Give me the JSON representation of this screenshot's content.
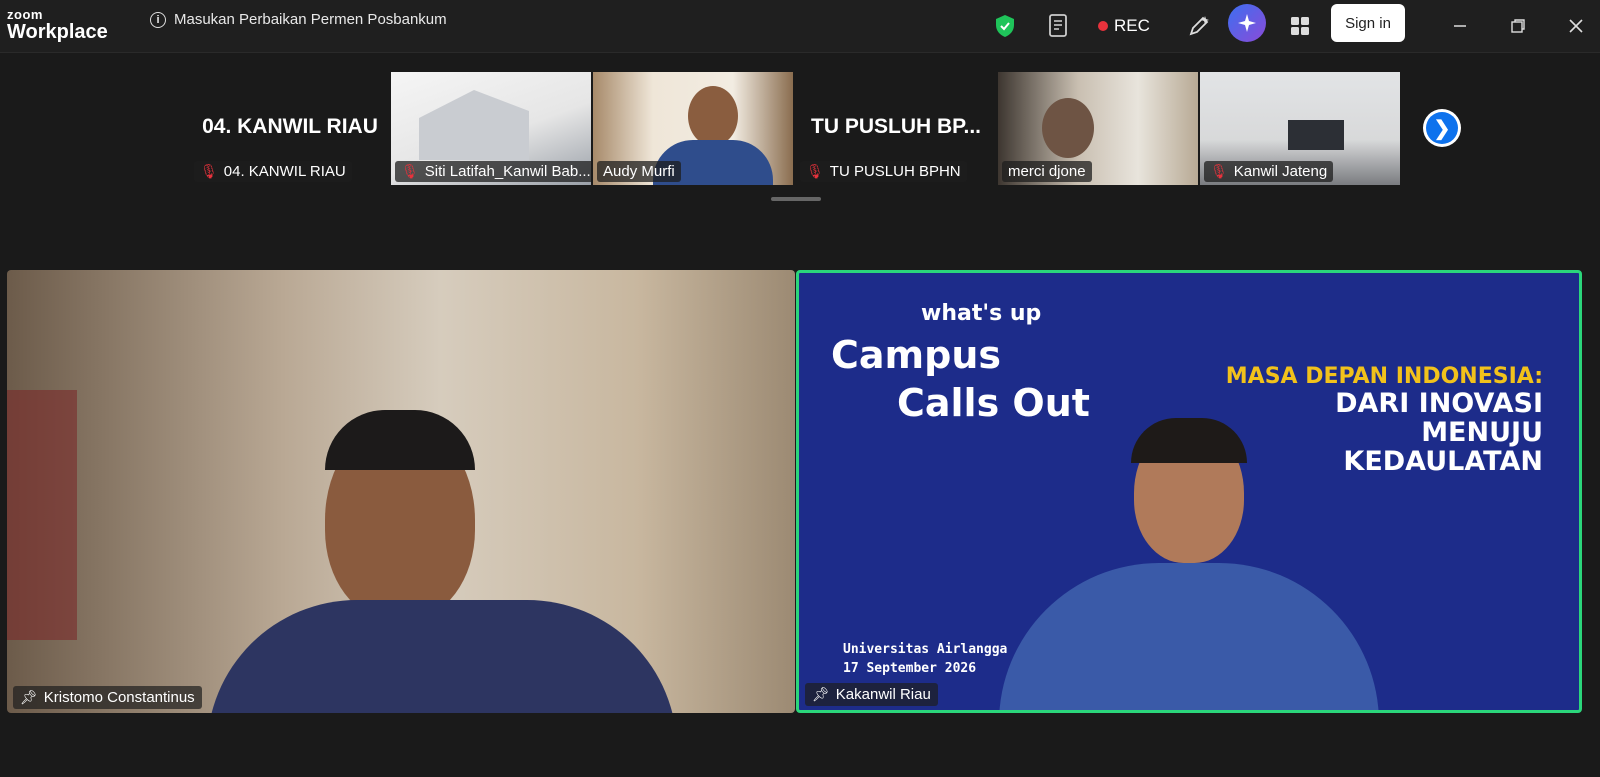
{
  "app": {
    "brand_top": "zoom",
    "brand_bottom": "Workplace"
  },
  "meeting": {
    "title": "Masukan Perbaikan Permen Posbankum"
  },
  "toolbar": {
    "rec_label": "REC",
    "signin_label": "Sign in"
  },
  "colors": {
    "active_speaker_border": "#2bd67b",
    "rec": "#e8323c",
    "accent": "#0e72ed",
    "shield": "#1fc45a"
  },
  "thumbnails": [
    {
      "display": "04. KANWIL RIAU",
      "name": "04. KANWIL RIAU",
      "muted": true
    },
    {
      "name": "Siti Latifah_Kanwil Bab...",
      "muted": true
    },
    {
      "name": "Audy Murfi",
      "muted": false
    },
    {
      "display": "TU PUSLUH BP...",
      "name": "TU PUSLUH BPHN",
      "muted": true
    },
    {
      "name": "merci djone",
      "muted": false
    },
    {
      "name": "Kanwil Jateng",
      "muted": true
    }
  ],
  "main": {
    "left": {
      "name": "Kristomo Constantinus"
    },
    "right": {
      "name": "Kakanwil Riau",
      "poster": {
        "whats": "what's up",
        "campus": "Campus",
        "calls": "Calls Out",
        "title1": "MASA DEPAN INDONESIA:",
        "title2": "DARI INOVASI",
        "title3": "MENUJU",
        "title4": "KEDAULATAN",
        "event1": "Universitas Airlangga",
        "event2": "17 September 2026"
      }
    }
  }
}
